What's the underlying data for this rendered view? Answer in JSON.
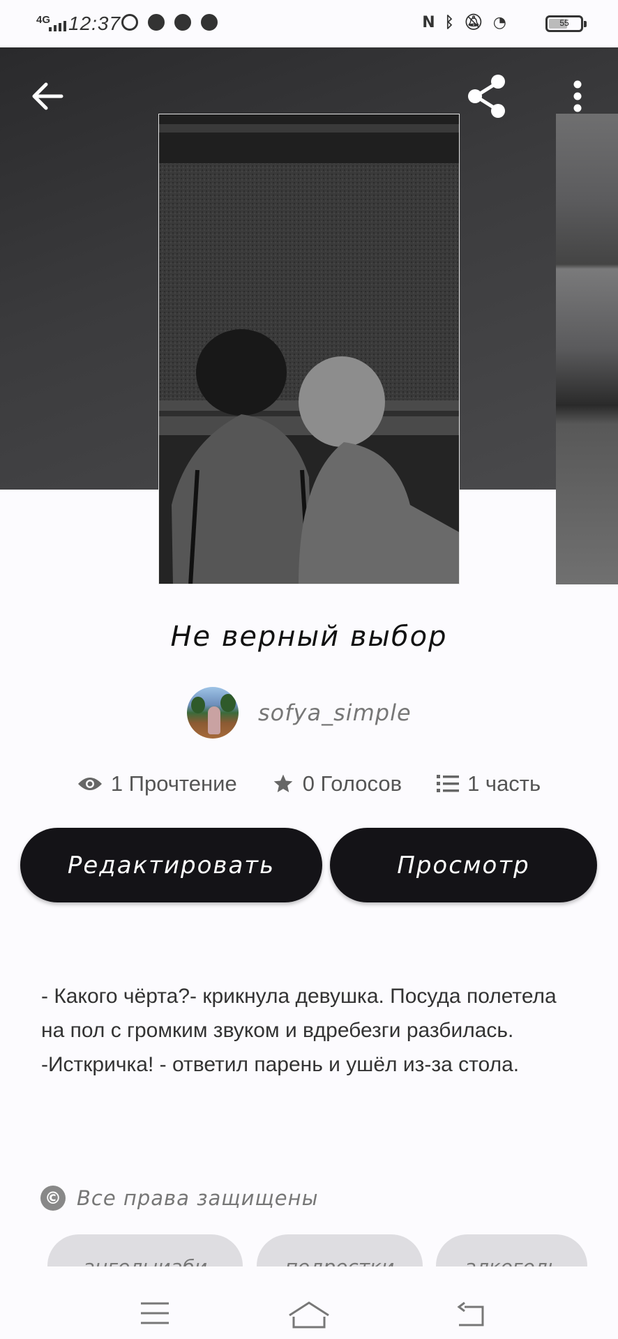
{
  "status_bar": {
    "network": "4G",
    "time": "12:37",
    "battery": "55"
  },
  "story": {
    "title": "Не верный выбор",
    "author": "sofya_simple",
    "stats": {
      "reads": "1 Прочтение",
      "votes": "0 Голосов",
      "parts": "1 часть"
    },
    "buttons": {
      "edit": "Редактировать",
      "view": "Просмотр"
    },
    "description": "- Какого чёрта?- крикнула девушка. Посуда полетела на пол с громким звуком и вдребезги разбилась.\n-Исткричка! - ответил парень и ушёл из-за стола.",
    "copyright": "Все права защищены",
    "tags": [
      "ангелыиаби",
      "подростки",
      "алкоголь"
    ]
  },
  "icons": {
    "back": "arrow-left-icon",
    "share": "share-icon",
    "more": "more-vertical-icon",
    "reads": "eye-icon",
    "votes": "star-icon",
    "parts": "list-icon",
    "copyright": "copyright-icon"
  },
  "colors": {
    "button_bg": "#141317",
    "hero_bg": "#2f2f31",
    "page_bg": "#fcfbfe"
  }
}
